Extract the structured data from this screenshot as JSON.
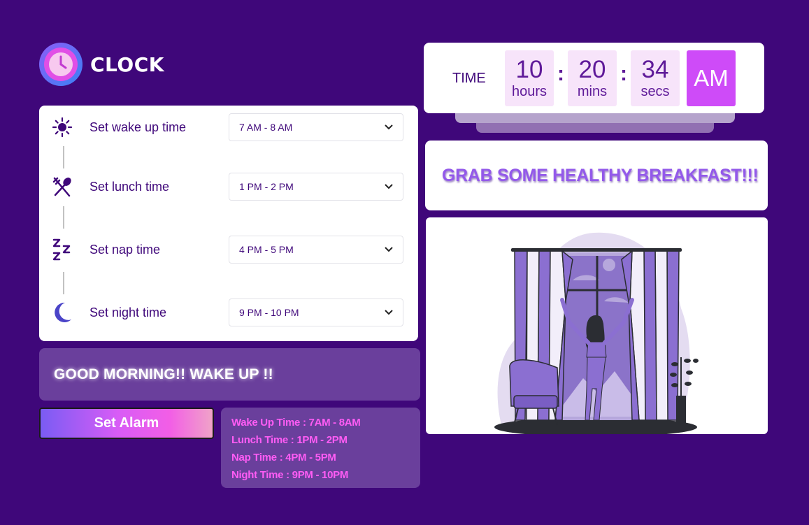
{
  "app": {
    "title": "CLOCK"
  },
  "schedule": [
    {
      "label": "Set wake up time",
      "value": "7 AM - 8 AM",
      "icon": "sun-icon"
    },
    {
      "label": "Set lunch time",
      "value": "1 PM - 2 PM",
      "icon": "fork-spoon-icon"
    },
    {
      "label": "Set nap time",
      "value": "4 PM - 5 PM",
      "icon": "zzz-icon"
    },
    {
      "label": "Set night time",
      "value": "9 PM - 10 PM",
      "icon": "moon-icon"
    }
  ],
  "greeting": "GOOD MORNING!! WAKE UP !!",
  "alarm_button": "Set Alarm",
  "summary": [
    "Wake Up Time : 7AM - 8AM",
    "Lunch Time : 1PM - 2PM",
    "Nap Time : 4PM - 5PM",
    "Night Time : 9PM - 10PM"
  ],
  "clock": {
    "label": "TIME",
    "hours": "10",
    "hours_unit": "hours",
    "mins": "20",
    "mins_unit": "mins",
    "secs": "34",
    "secs_unit": "secs",
    "ampm": "AM"
  },
  "message": "GRAB SOME HEALTHY BREAKFAST!!!",
  "colors": {
    "background": "#3f077a",
    "accent": "#ce4bf8",
    "panel": "#6a3f9c",
    "summary_text": "#ff5cf5"
  }
}
